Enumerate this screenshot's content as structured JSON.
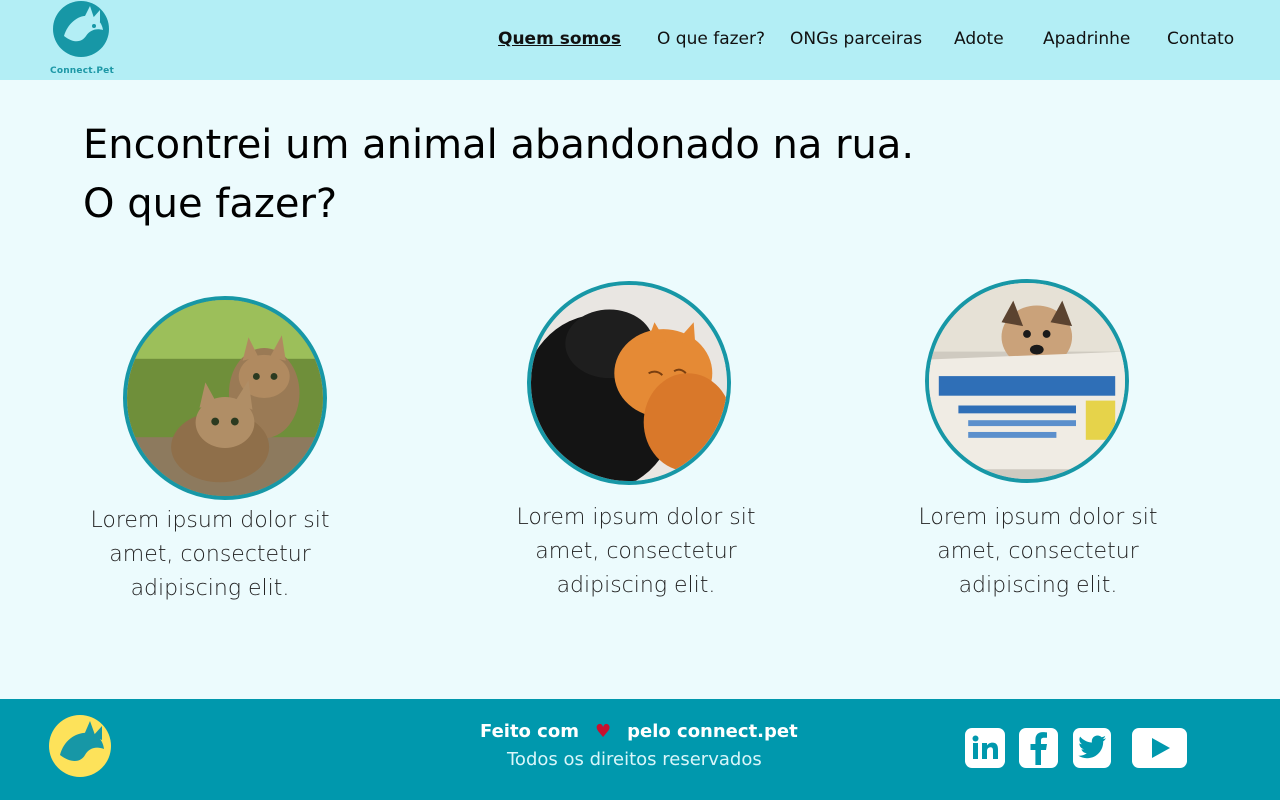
{
  "brand": {
    "name": "Connect.Pet"
  },
  "nav": {
    "items": [
      {
        "label": "Quem somos",
        "active": true
      },
      {
        "label": "O que fazer?"
      },
      {
        "label": "ONGs parceiras"
      },
      {
        "label": "Adote"
      },
      {
        "label": "Apadrinhe"
      },
      {
        "label": "Contato"
      }
    ]
  },
  "main": {
    "title_line1": "Encontrei um animal abandonado na rua.",
    "title_line2": "O que fazer?",
    "cards": [
      {
        "image": "two-kittens-photo",
        "text": "Lorem ipsum dolor sit amet, consectetur adipiscing elit."
      },
      {
        "image": "dog-and-cat-cuddling-photo",
        "text": "Lorem ipsum dolor sit amet, consectetur adipiscing elit."
      },
      {
        "image": "dog-in-cardboard-box-photo",
        "text": "Lorem ipsum dolor sit amet, consectetur adipiscing elit."
      }
    ]
  },
  "footer": {
    "made_with": "Feito com",
    "made_by": "pelo connect.pet",
    "rights": "Todos os direitos reservados",
    "social": [
      "linkedin-icon",
      "facebook-icon",
      "twitter-icon",
      "youtube-icon"
    ]
  },
  "colors": {
    "header_bg": "#b3eef5",
    "page_bg": "#ecfbfd",
    "footer_bg": "#0098ad",
    "accent_teal": "#1797a6",
    "footer_logo_yellow": "#fde25a",
    "heart_red": "#c8102e"
  }
}
